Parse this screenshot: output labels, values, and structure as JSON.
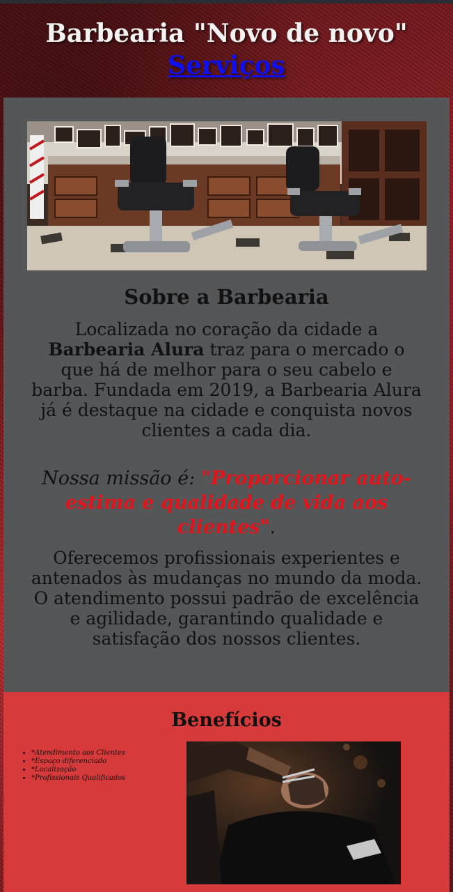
{
  "header": {
    "title": "Barbearia \"Novo de novo\"",
    "nav_link": "Serviços"
  },
  "about": {
    "title": "Sobre a Barbearia",
    "p1_before": "Localizada no coração da cidade a ",
    "p1_bold": "Barbearia Alura",
    "p1_after": " traz para o mercado o que há de melhor para o seu cabelo e barba. Fundada em 2019, a Barbearia Alura já é destaque na cidade e conquista novos clientes a cada dia.",
    "mission_label": "Nossa missão é: ",
    "mission_quote": "\"Proporcionar auto-estima e qualidade de vida aos clientes\"",
    "mission_end": ".",
    "p3": "Oferecemos profissionais experientes e antenados às mudanças no mundo da moda. O atendimento possui padrão de excelência e agilidade, garantindo qualidade e satisfação dos nossos clientes."
  },
  "benefits": {
    "title": "Benefícios",
    "items": [
      "*Atendimento aos Clientes",
      "*Espaço diferenciado",
      "*Localização",
      "*Profissionais Qualificados"
    ]
  },
  "colors": {
    "header_bg": "#8d1a1f",
    "main_bg": "#555657",
    "benefits_bg": "#d63a3a",
    "mission_quote": "#e0141a",
    "link": "#1010ee"
  }
}
